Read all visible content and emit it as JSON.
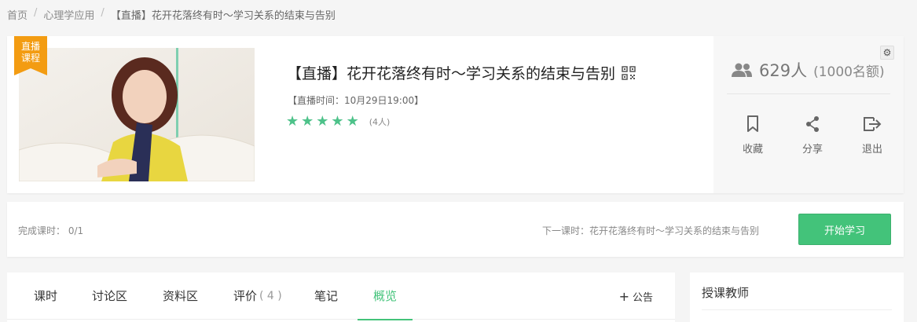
{
  "breadcrumb": {
    "home": "首页",
    "category": "心理学应用",
    "current": "【直播】花开花落终有时～学习关系的结束与告别",
    "separator": "/"
  },
  "course": {
    "ribbon": "直播课程",
    "title": "【直播】花开花落终有时～学习关系的结束与告别",
    "live_time": "【直播时间：10月29日19:00】",
    "stars": 5,
    "rating_count": "(4人)"
  },
  "side": {
    "students": "629人",
    "quota": "(1000名额)",
    "actions": [
      {
        "label": "收藏",
        "icon": "bookmark-icon"
      },
      {
        "label": "分享",
        "icon": "share-icon"
      },
      {
        "label": "退出",
        "icon": "exit-icon"
      }
    ]
  },
  "progress": {
    "done": "完成课时： 0/1",
    "next": "下一课时：花开花落终有时～学习关系的结束与告别",
    "start_button": "开始学习"
  },
  "tabs": [
    {
      "label": "课时",
      "count": ""
    },
    {
      "label": "讨论区",
      "count": ""
    },
    {
      "label": "资料区",
      "count": ""
    },
    {
      "label": "评价",
      "count": "( 4 )"
    },
    {
      "label": "笔记",
      "count": ""
    },
    {
      "label": "概览",
      "count": ""
    }
  ],
  "active_tab": "概览",
  "announce": "公告",
  "teacher": {
    "title": "授课教师"
  },
  "colors": {
    "accent": "#43c37a",
    "ribbon": "#f39c12",
    "star": "#4ec28a"
  }
}
